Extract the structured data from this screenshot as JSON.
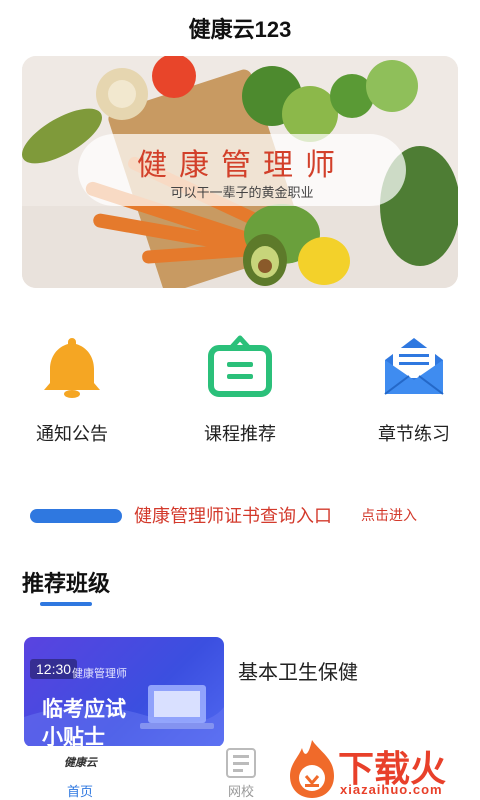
{
  "header": {
    "title": "健康云123"
  },
  "banner": {
    "title": "健康管理师",
    "subtitle": "可以干一辈子的黄金职业"
  },
  "quick_links": [
    {
      "label": "通知公告",
      "icon": "bell-icon",
      "color": "#f5a623"
    },
    {
      "label": "课程推荐",
      "icon": "clipboard-icon",
      "color": "#2bc07a"
    },
    {
      "label": "章节练习",
      "icon": "mail-icon",
      "color": "#2f78e0"
    }
  ],
  "notice": {
    "text": "健康管理师证书查询入口",
    "link": "点击进入"
  },
  "section": {
    "title": "推荐班级"
  },
  "course": {
    "time": "12:30",
    "tag": "健康管理师",
    "thumb_line1": "临考应试",
    "thumb_line2": "小贴士",
    "name": "基本卫生保健"
  },
  "tabbar": {
    "home_label": "首页",
    "home_logo": "健康云",
    "school_label": "网校"
  },
  "watermark": {
    "text": "下载火",
    "sub": "xiazaihuo.com"
  },
  "colors": {
    "accent": "#2f78e0",
    "notice_red": "#d33a2c"
  }
}
